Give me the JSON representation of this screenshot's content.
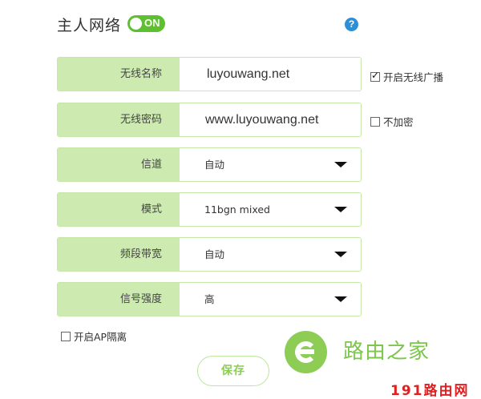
{
  "header": {
    "title": "主人网络",
    "toggle_label": "ON",
    "help_glyph": "?"
  },
  "fields": [
    {
      "label": "无线名称",
      "value": "luyouwang.net"
    },
    {
      "label": "无线密码",
      "value": "www.luyouwang.net"
    },
    {
      "label": "信道",
      "value": "自动"
    },
    {
      "label": "模式",
      "value": "11bgn mixed"
    },
    {
      "label": "频段带宽",
      "value": "自动"
    },
    {
      "label": "信号强度",
      "value": "高"
    }
  ],
  "options": {
    "broadcast": {
      "label": "开启无线广播",
      "checked": true
    },
    "no_encrypt": {
      "label": "不加密",
      "checked": false
    },
    "ap_isolation": {
      "label": "开启AP隔离",
      "checked": false
    }
  },
  "actions": {
    "save_label": "保存"
  },
  "watermark": {
    "brand": "路由之家",
    "site": "191路由网"
  },
  "colors": {
    "accent_green": "#5dc12f",
    "label_bg": "#cdebb0",
    "help_blue": "#2d8fd6",
    "watermark_red": "#e02020"
  },
  "icons": [
    "help-icon",
    "dropdown-caret-icon",
    "checkbox-icon",
    "watermark-logo-icon"
  ]
}
